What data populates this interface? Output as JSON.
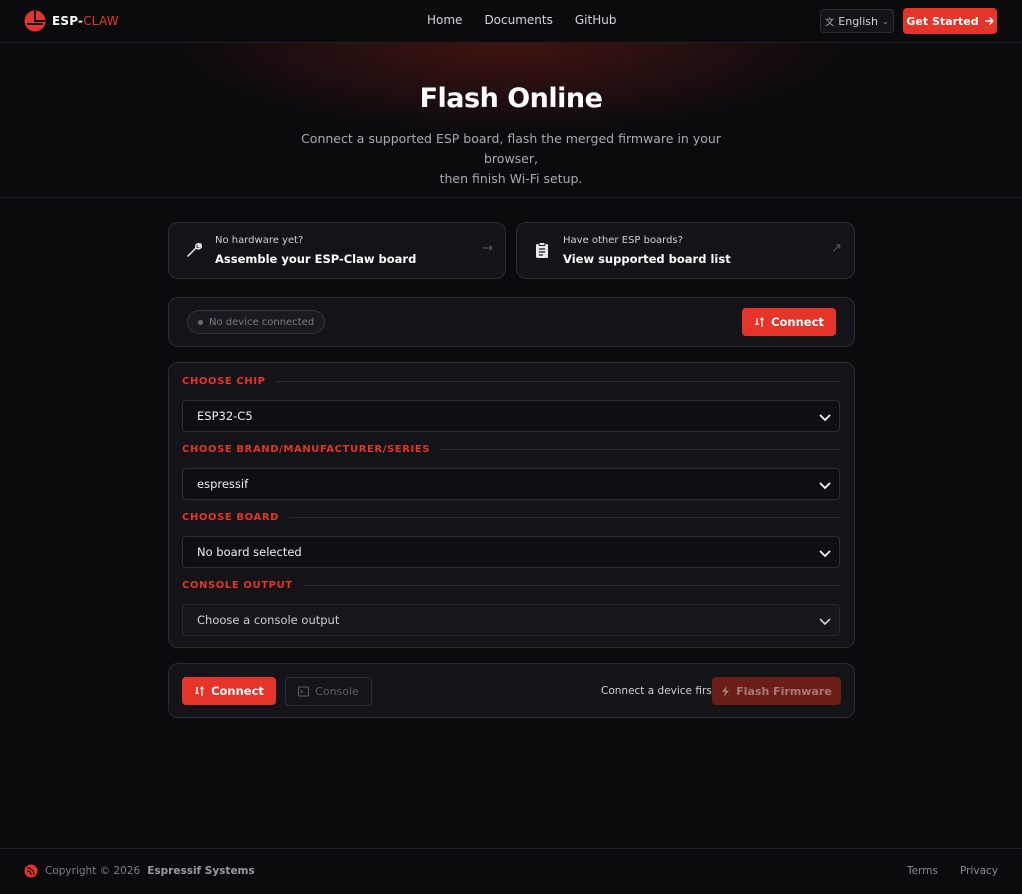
{
  "nav": {
    "logo_primary": "ESP-",
    "logo_accent": "CLAW",
    "links": [
      "Home",
      "Documents",
      "GitHub"
    ],
    "language": "English",
    "cta": "Get Started"
  },
  "hero": {
    "title": "Flash Online",
    "subtitle_line1": "Connect a supported ESP board, flash the merged firmware in your browser,",
    "subtitle_line2": "then finish Wi-Fi setup."
  },
  "cards": {
    "assemble": {
      "small": "No hardware yet?",
      "big": "Assemble your ESP-Claw board",
      "icon": "wrench-icon"
    },
    "boards": {
      "small": "Have other ESP boards?",
      "big": "View supported board list",
      "icon": "clipboard-icon"
    }
  },
  "status": {
    "pill": "No device connected",
    "connect": "Connect"
  },
  "form": {
    "chip_label": "CHOOSE CHIP",
    "chip_value": "ESP32-C5",
    "brand_label": "CHOOSE BRAND/MANUFACTURER/SERIES",
    "brand_value": "espressif",
    "board_label": "CHOOSE BOARD",
    "board_value": "No board selected",
    "console_label": "CONSOLE OUTPUT",
    "console_value": "Choose a console output"
  },
  "actions": {
    "connect": "Connect",
    "console": "Console",
    "hint": "Connect a device first",
    "flash": "Flash Firmware"
  },
  "footer": {
    "copyright_prefix": "Copyright © 2026",
    "company": "Espressif Systems",
    "links": [
      "Terms",
      "Privacy"
    ]
  },
  "colors": {
    "accent": "#e5342a",
    "background": "#0b0b0e",
    "card": "#131318"
  }
}
